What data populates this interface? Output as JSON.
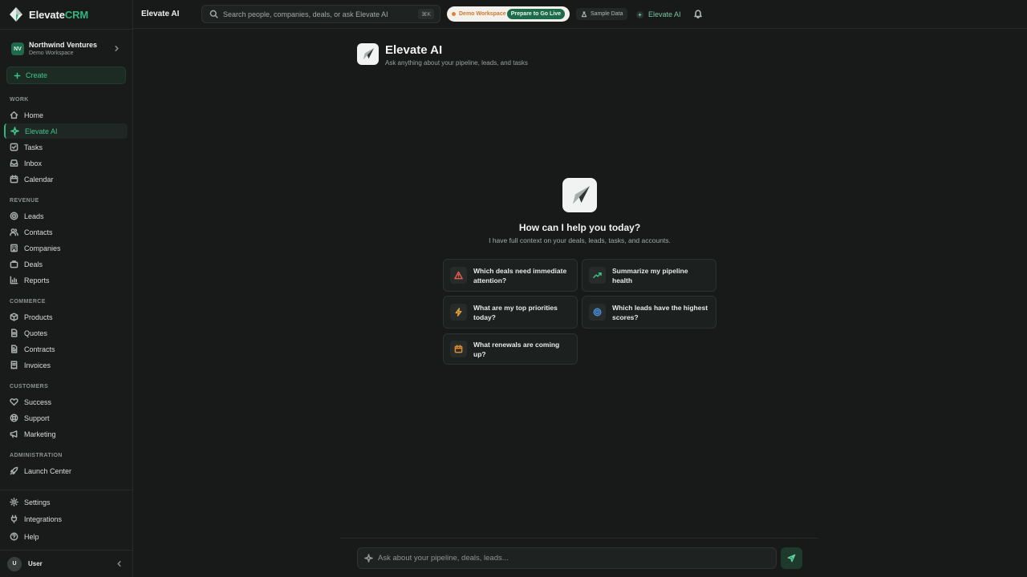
{
  "brand": {
    "name_main": "Elevate",
    "name_accent": "CRM",
    "accent_color": "#2fb67f"
  },
  "workspace": {
    "initials": "NV",
    "name": "Northwind Ventures",
    "subtitle": "Demo Workspace"
  },
  "create_label": "Create",
  "sections": {
    "work": "WORK",
    "revenue": "REVENUE",
    "commerce": "COMMERCE",
    "customers": "CUSTOMERS",
    "administration": "ADMINISTRATION"
  },
  "nav": {
    "work": [
      "Home",
      "Elevate AI",
      "Tasks",
      "Inbox",
      "Calendar"
    ],
    "revenue": [
      "Leads",
      "Contacts",
      "Companies",
      "Deals",
      "Reports"
    ],
    "commerce": [
      "Products",
      "Quotes",
      "Contracts",
      "Invoices"
    ],
    "customers": [
      "Success",
      "Support",
      "Marketing"
    ],
    "administration": [
      "Launch Center"
    ],
    "footer": [
      "Settings",
      "Integrations",
      "Help"
    ]
  },
  "active_nav": "Elevate AI",
  "user": {
    "initial": "U",
    "name": "User"
  },
  "topbar": {
    "page_title": "Elevate AI",
    "search_placeholder": "Search people, companies, deals, or ask Elevate AI",
    "search_shortcut": "⌘K",
    "demo_label": "Demo Workspace",
    "go_live_label": "Prepare to Go Live",
    "sample_data_label": "Sample Data",
    "ai_link_label": "Elevate AI"
  },
  "header": {
    "title": "Elevate AI",
    "subtitle": "Ask anything about your pipeline, leads, and tasks"
  },
  "hero": {
    "title": "How can I help you today?",
    "subtitle": "I have full context on your deals, leads, tasks, and accounts."
  },
  "suggestions": [
    {
      "text": "Which deals need immediate attention?",
      "icon": "alert-triangle-icon",
      "color": "#e05a4f"
    },
    {
      "text": "Summarize my pipeline health",
      "icon": "trending-up-icon",
      "color": "#3fbf85"
    },
    {
      "text": "What are my top priorities today?",
      "icon": "lightning-icon",
      "color": "#e0a33a"
    },
    {
      "text": "Which leads have the highest scores?",
      "icon": "target-icon",
      "color": "#4a90e2"
    },
    {
      "text": "What renewals are coming up?",
      "icon": "calendar-icon",
      "color": "#e08b2f"
    }
  ],
  "composer": {
    "placeholder": "Ask about your pipeline, deals, leads..."
  }
}
